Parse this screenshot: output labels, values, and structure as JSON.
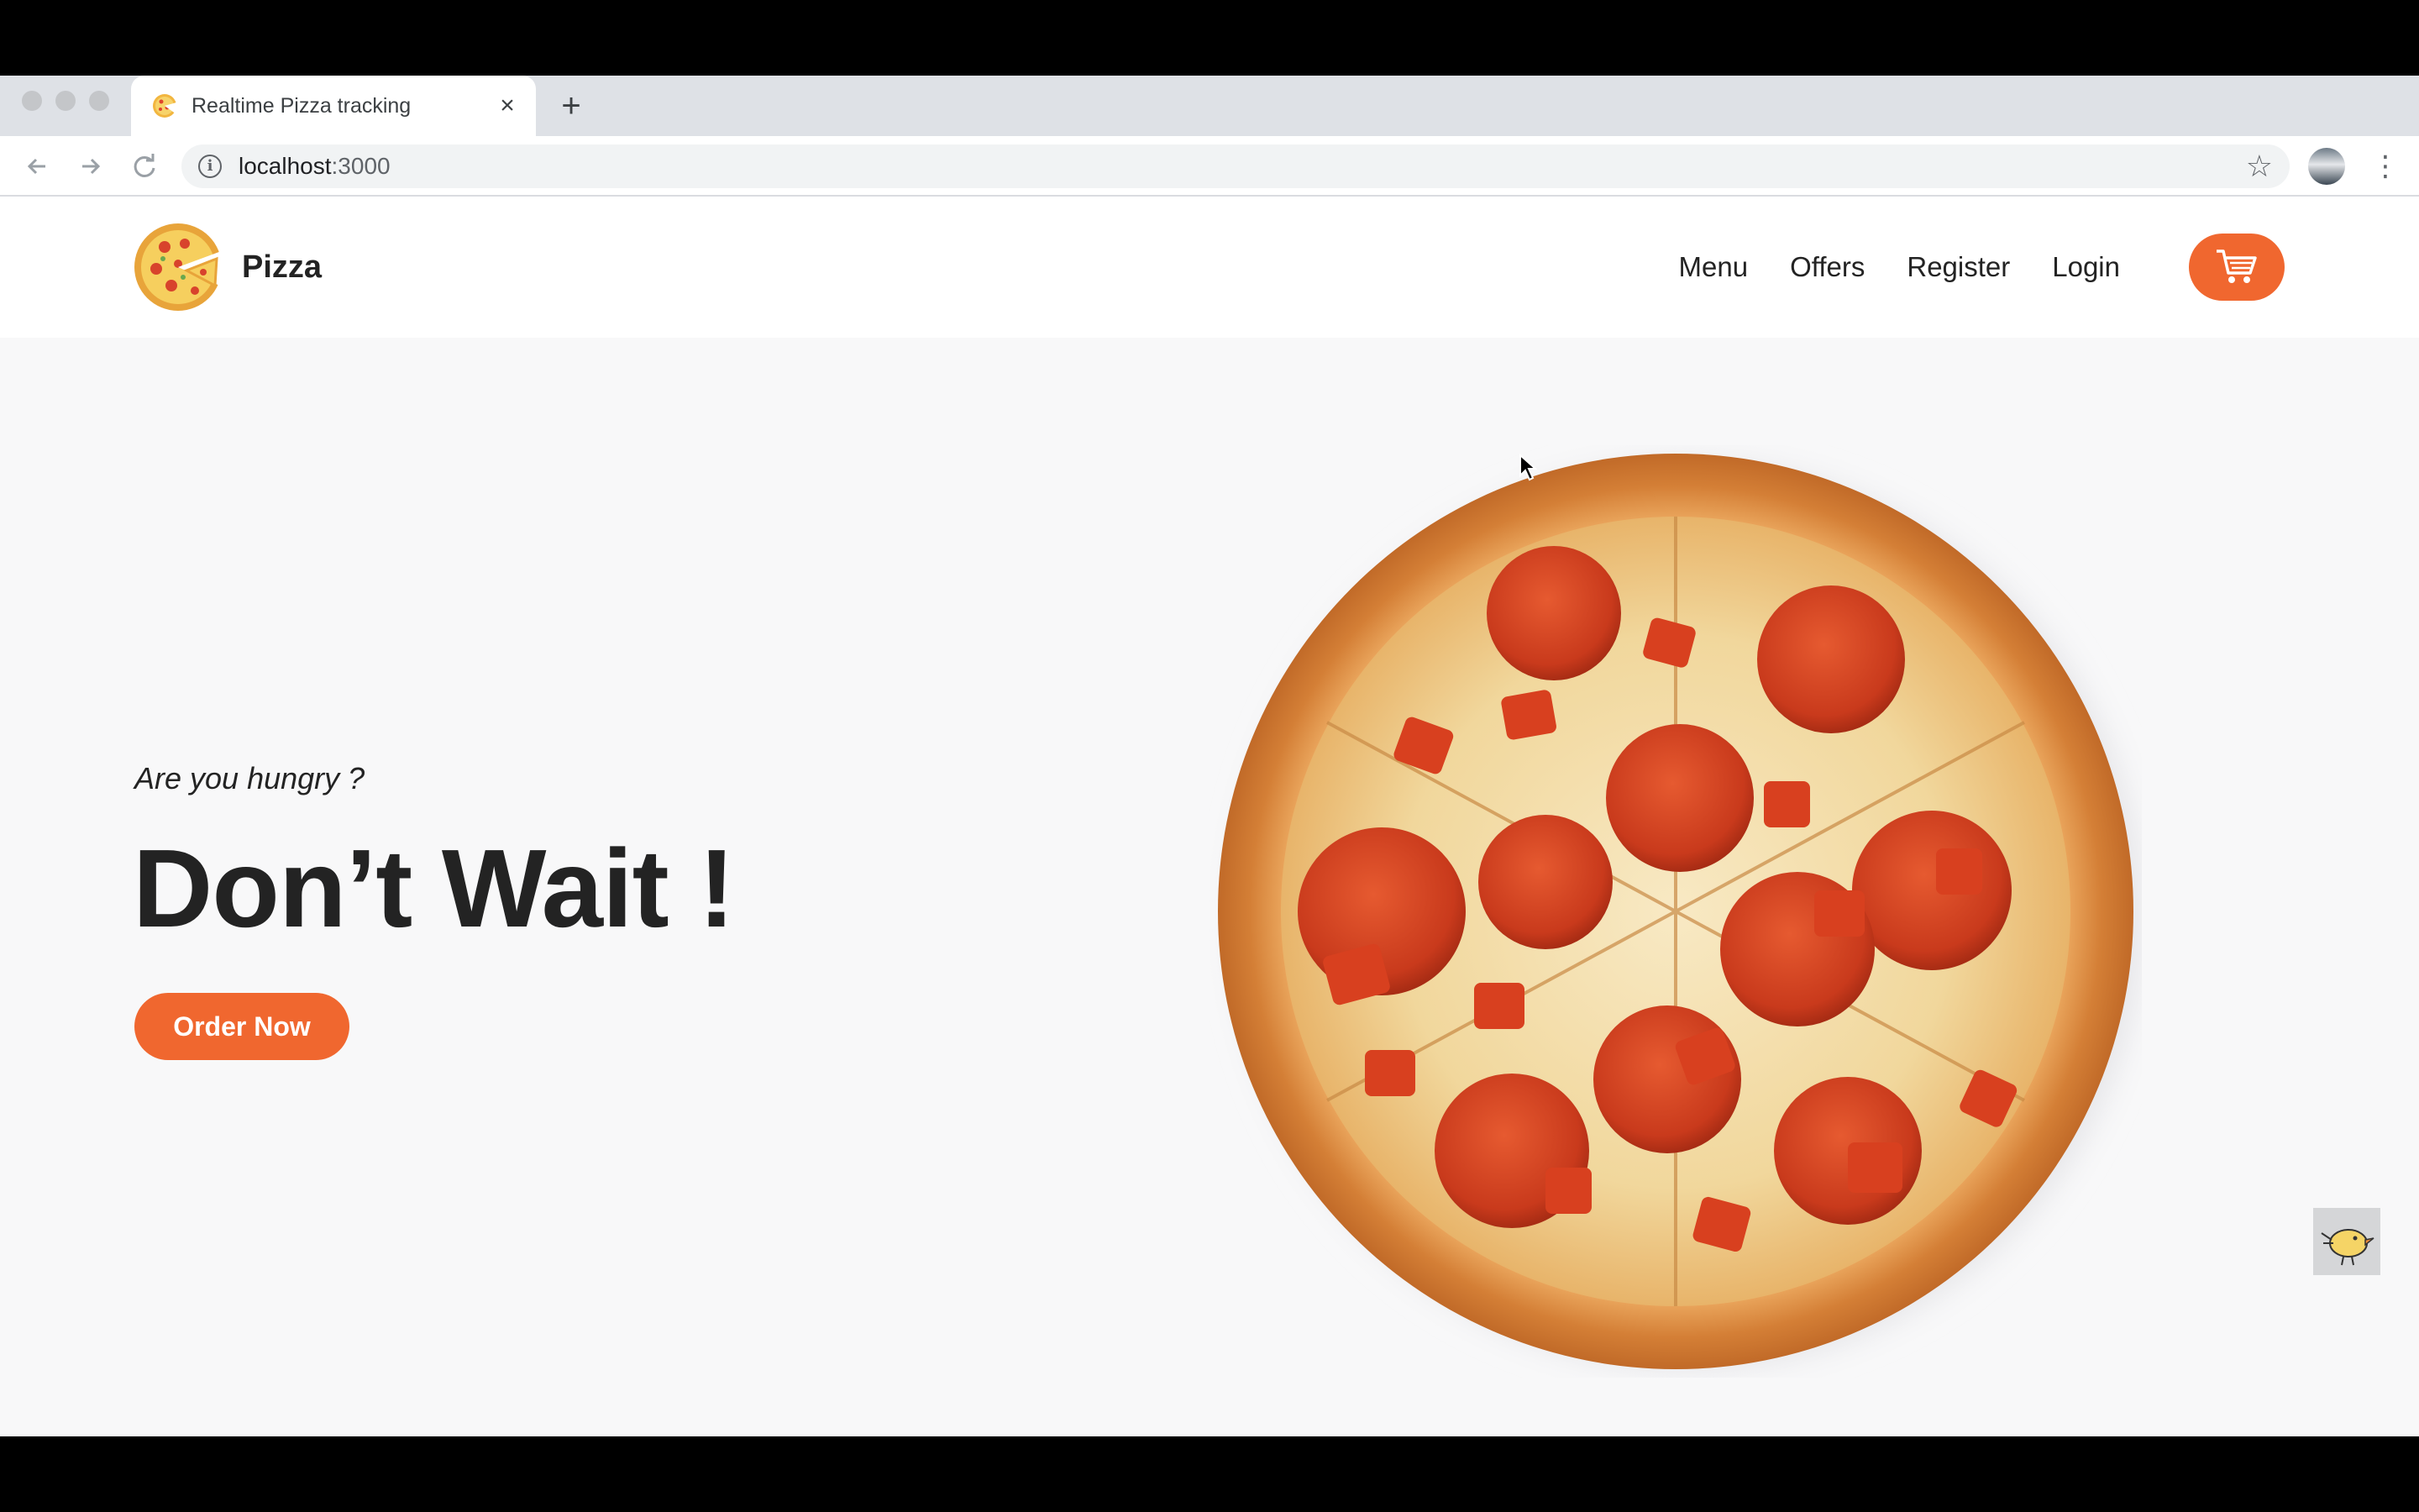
{
  "browser": {
    "tab": {
      "title": "Realtime Pizza tracking",
      "close_label": "×"
    },
    "new_tab_label": "+",
    "address": {
      "host": "localhost",
      "port": ":3000"
    }
  },
  "site": {
    "brand": "Pizza",
    "nav": [
      {
        "label": "Menu"
      },
      {
        "label": "Offers"
      },
      {
        "label": "Register"
      },
      {
        "label": "Login"
      }
    ],
    "hero": {
      "subtitle": "Are you hungry ?",
      "title": "Don’t Wait !",
      "cta": "Order Now"
    }
  },
  "colors": {
    "accent": "#f0672f",
    "text": "#232323",
    "page_bg": "#f8f8f9"
  },
  "icons": {
    "back": "arrow-back-icon",
    "forward": "arrow-forward-icon",
    "reload": "reload-icon",
    "info": "info-icon",
    "bookmark": "star-icon",
    "menu": "kebab-menu-icon",
    "cart": "cart-icon",
    "logo": "pizza-slice-logo-icon"
  }
}
